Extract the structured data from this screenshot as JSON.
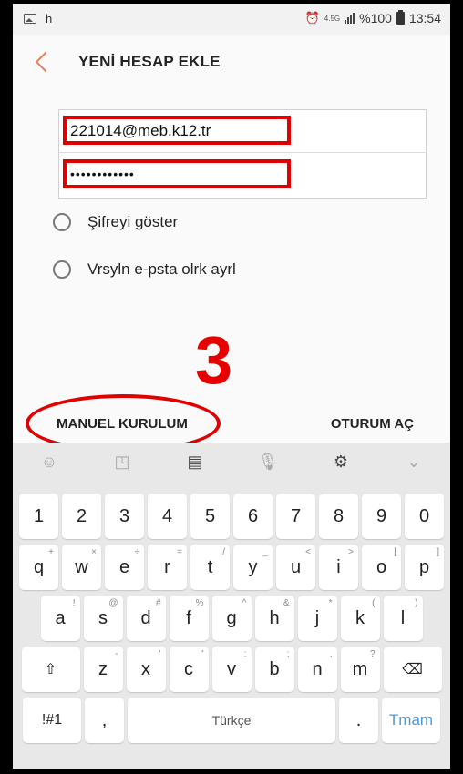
{
  "status_bar": {
    "notif": "h",
    "net_label": "4.5G",
    "battery_text": "%100",
    "time": "13:54"
  },
  "header": {
    "title": "YENİ HESAP EKLE"
  },
  "form": {
    "email_value": "221014@meb.k12.tr",
    "password_value": "••••••••••••"
  },
  "options": [
    {
      "label": "Şifreyi göster"
    },
    {
      "label": "Vrsyln e-psta olrk ayrl"
    }
  ],
  "annotation": {
    "step_number": "3"
  },
  "actions": {
    "manual_setup": "MANUEL KURULUM",
    "sign_in": "OTURUM AÇ"
  },
  "keyboard": {
    "tools": {
      "emoji": "☺",
      "sticker": "◳",
      "clipboard": "▤",
      "mic": "🎙",
      "settings": "⚙",
      "collapse": "⌄"
    },
    "row1": [
      "1",
      "2",
      "3",
      "4",
      "5",
      "6",
      "7",
      "8",
      "9",
      "0"
    ],
    "row2": [
      [
        "q",
        "+"
      ],
      [
        "w",
        "×"
      ],
      [
        "e",
        "÷"
      ],
      [
        "r",
        "="
      ],
      [
        "t",
        "/"
      ],
      [
        "y",
        "_"
      ],
      [
        "u",
        "<"
      ],
      [
        "i",
        ">"
      ],
      [
        "o",
        "["
      ],
      [
        "p",
        "]"
      ]
    ],
    "row3": [
      [
        "a",
        "!"
      ],
      [
        "s",
        "@"
      ],
      [
        "d",
        "#"
      ],
      [
        "f",
        "%"
      ],
      [
        "g",
        "^"
      ],
      [
        "h",
        "&"
      ],
      [
        "j",
        "*"
      ],
      [
        "k",
        "("
      ],
      [
        "l",
        ")"
      ]
    ],
    "row4": [
      [
        "z",
        "-"
      ],
      [
        "x",
        "'"
      ],
      [
        "c",
        "\""
      ],
      [
        "v",
        ":"
      ],
      [
        "b",
        ";"
      ],
      [
        "n",
        ","
      ],
      [
        "m",
        "?"
      ]
    ],
    "shift": "⇧",
    "backspace": "⌫",
    "sym": "!#1",
    "comma": ",",
    "space": "Türkçe",
    "period": ".",
    "done": "Tmam"
  }
}
